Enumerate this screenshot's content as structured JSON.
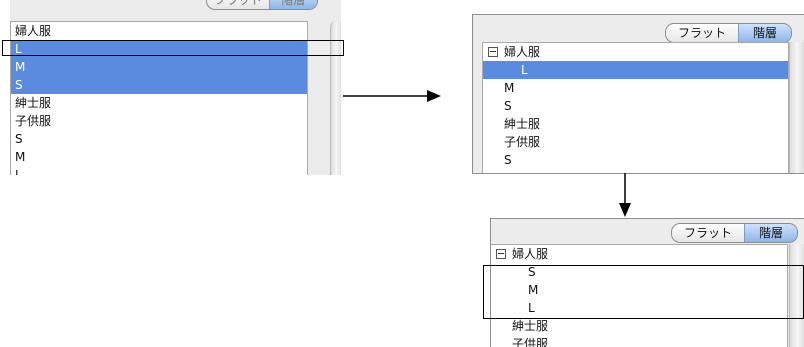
{
  "segment": {
    "flat_label": "フラット",
    "hier_label": "階層"
  },
  "flat_list": {
    "items": [
      "婦人服",
      "L",
      "M",
      "S",
      "紳士服",
      "子供服",
      "S",
      "M",
      "L"
    ]
  },
  "tree_list_1": {
    "parent": "婦人服",
    "child": "L",
    "items": [
      "M",
      "S",
      "紳士服",
      "子供服",
      "S"
    ]
  },
  "tree_list_2": {
    "parent": "婦人服",
    "children": [
      "S",
      "M",
      "L"
    ],
    "items": [
      "紳士服",
      "子供服"
    ]
  }
}
